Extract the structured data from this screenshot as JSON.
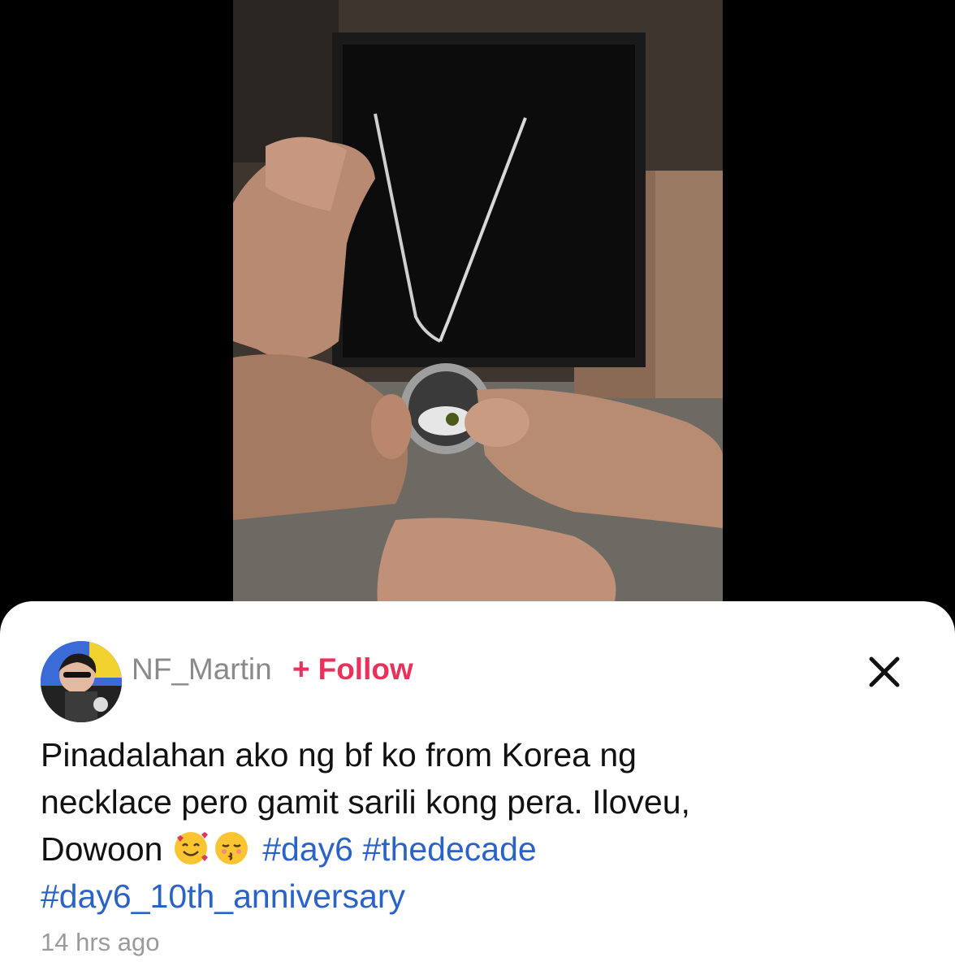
{
  "post": {
    "username": "NF_Martin",
    "follow_plus": "+",
    "follow_label": "Follow",
    "caption_line1": "Pinadalahan ako ng bf ko from Korea ng",
    "caption_line2": "necklace pero gamit sarili kong pera. Iloveu,",
    "caption_line3_text": "Dowoon",
    "emojis": [
      "smiling-face-with-hearts",
      "kissing-face-with-closed-eyes"
    ],
    "hashtags": [
      "#day6",
      "#thedecade",
      "#day6_10th_anniversary"
    ],
    "timestamp": "14 hrs ago"
  },
  "icons": {
    "close": "close-icon",
    "avatar": "avatar"
  },
  "colors": {
    "follow": "#e8325c",
    "hashtag": "#2b62c7",
    "username": "#8a8a8a",
    "timestamp": "#9a9a9a"
  }
}
